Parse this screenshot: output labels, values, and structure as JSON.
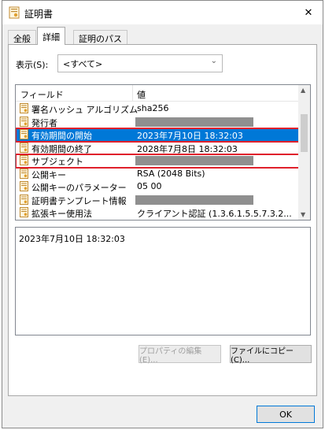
{
  "window": {
    "title": "証明書"
  },
  "tabs": [
    "全般",
    "詳細",
    "証明のパス"
  ],
  "active_tab": "詳細",
  "show": {
    "label": "表示(S):",
    "selected": "<すべて>"
  },
  "list": {
    "columns": [
      "フィールド",
      "値"
    ],
    "rows": [
      {
        "field": "署名ハッシュ アルゴリズム",
        "value": "sha256",
        "redacted": false
      },
      {
        "field": "発行者",
        "value": "",
        "redacted": true
      },
      {
        "field": "有効期間の開始",
        "value": "2023年7月10日 18:32:03",
        "redacted": false,
        "selected": true,
        "boxed": true
      },
      {
        "field": "有効期間の終了",
        "value": "2028年7月8日 18:32:03",
        "redacted": false
      },
      {
        "field": "サブジェクト",
        "value": "",
        "redacted": true,
        "boxed": true
      },
      {
        "field": "公開キー",
        "value": "RSA (2048 Bits)",
        "redacted": false
      },
      {
        "field": "公開キーのパラメーター",
        "value": "05 00",
        "redacted": false
      },
      {
        "field": "証明書テンプレート情報",
        "value": "",
        "redacted": true
      },
      {
        "field": "拡張キー使用法",
        "value": "クライアント認証 (1.3.6.1.5.5.7.3.2...",
        "redacted": false
      }
    ]
  },
  "detail_text": "2023年7月10日 18:32:03",
  "buttons": {
    "properties": "プロパティの編集(E)...",
    "copy_to_file": "ファイルにコピー(C)...",
    "ok": "OK"
  },
  "colors": {
    "selection": "#0078d7",
    "highlight_box": "#e0202b",
    "redaction": "#8f8f8f"
  }
}
